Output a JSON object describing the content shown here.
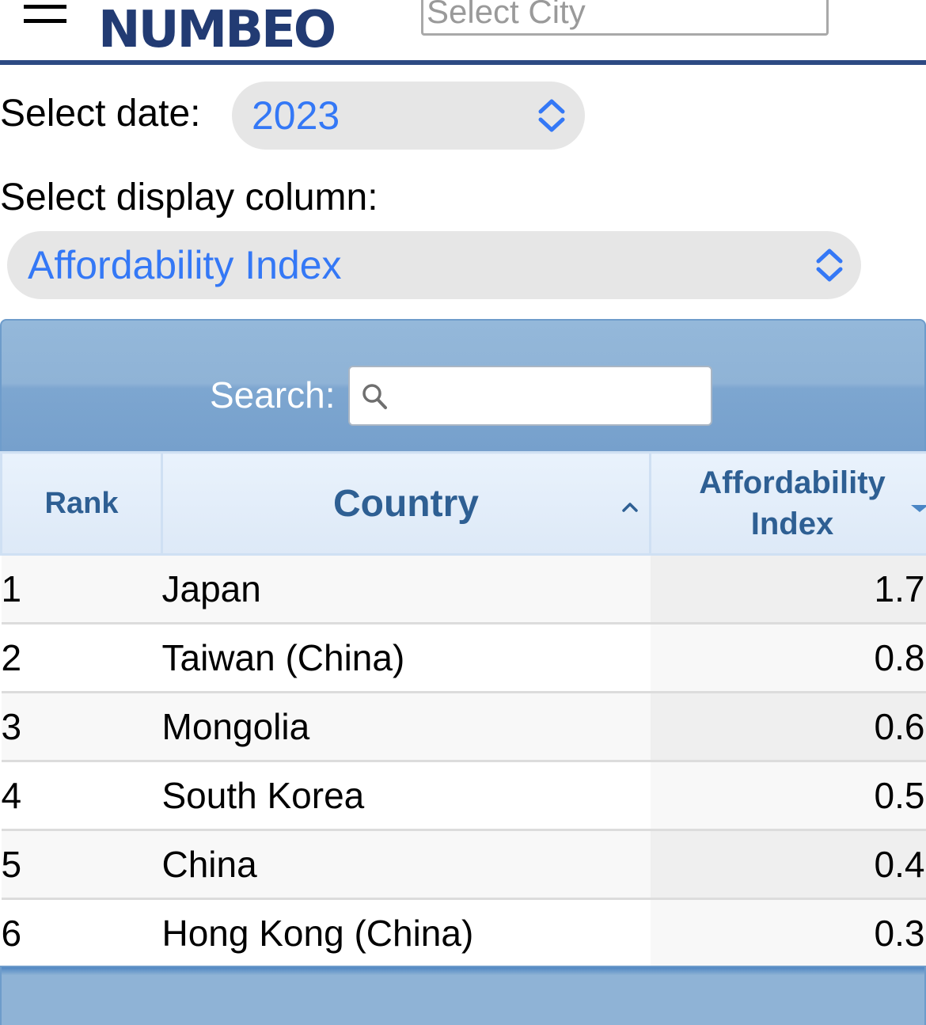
{
  "header": {
    "logo": "NUMBEO",
    "city_search": {
      "placeholder": "Select City"
    }
  },
  "filters": {
    "date_label": "Select date:",
    "date_value": "2023",
    "column_label": "Select display column:",
    "column_value": "Affordability Index"
  },
  "table": {
    "search_label": "Search:",
    "search_value": "",
    "columns": {
      "rank": "Rank",
      "country": "Country",
      "index_line1": "Affordability",
      "index_line2": "Index"
    },
    "rows": [
      {
        "rank": "1",
        "country": "Japan",
        "value": "1.7"
      },
      {
        "rank": "2",
        "country": "Taiwan (China)",
        "value": "0.8"
      },
      {
        "rank": "3",
        "country": "Mongolia",
        "value": "0.6"
      },
      {
        "rank": "4",
        "country": "South Korea",
        "value": "0.5"
      },
      {
        "rank": "5",
        "country": "China",
        "value": "0.4"
      },
      {
        "rank": "6",
        "country": "Hong Kong (China)",
        "value": "0.3"
      }
    ]
  },
  "colors": {
    "brand": "#223b73",
    "select_text": "#3478f6",
    "header_text": "#2e5f93",
    "toolbar": "#8fb3d6"
  }
}
